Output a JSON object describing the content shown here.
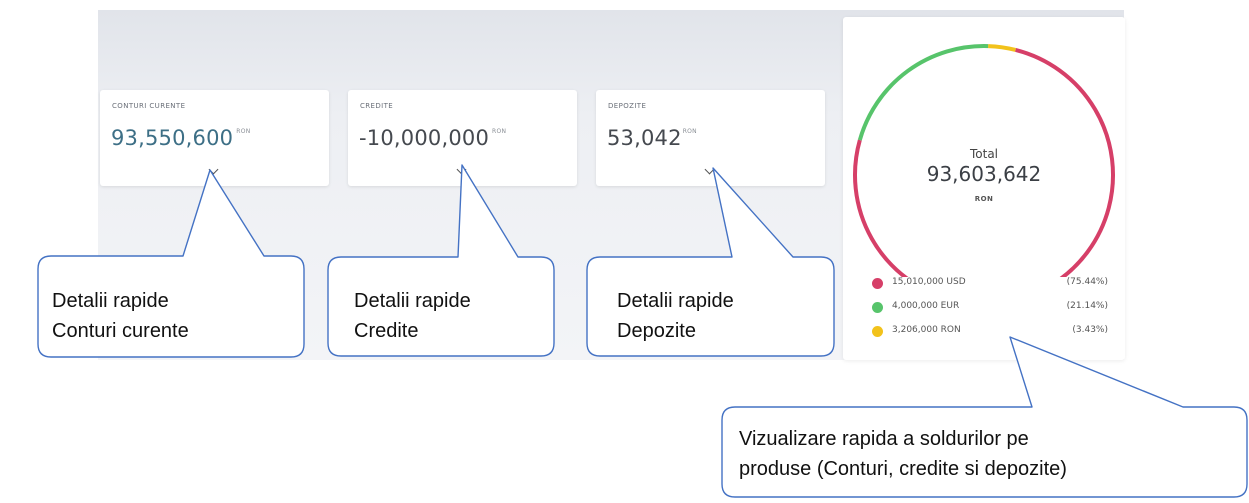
{
  "cards": [
    {
      "label": "CONTURI CURENTE",
      "value": "93,550,600",
      "currency": "RON"
    },
    {
      "label": "CREDITE",
      "value": "-10,000,000",
      "currency": "RON"
    },
    {
      "label": "DEPOZITE",
      "value": "53,042",
      "currency": "RON"
    }
  ],
  "total": {
    "label": "Total",
    "value": "93,603,642",
    "currency": "RON"
  },
  "chart_data": {
    "type": "pie",
    "categories": [
      "15,010,000 USD",
      "4,000,000 EUR",
      "3,206,000 RON"
    ],
    "values": [
      75.44,
      21.14,
      3.43
    ],
    "colors": [
      "#d63f68",
      "#57c46b",
      "#f2c21b"
    ],
    "percent_labels": [
      "(75.44%)",
      "(21.14%)",
      "(3.43%)"
    ]
  },
  "callouts": [
    {
      "line1": "Detalii rapide",
      "line2": "Conturi curente"
    },
    {
      "line1": "Detalii rapide",
      "line2": "Credite"
    },
    {
      "line1": "Detalii rapide",
      "line2": "Depozite"
    },
    {
      "line1": "Vizualizare rapida a soldurilor pe",
      "line2": "produse (Conturi, credite si depozite)"
    }
  ]
}
